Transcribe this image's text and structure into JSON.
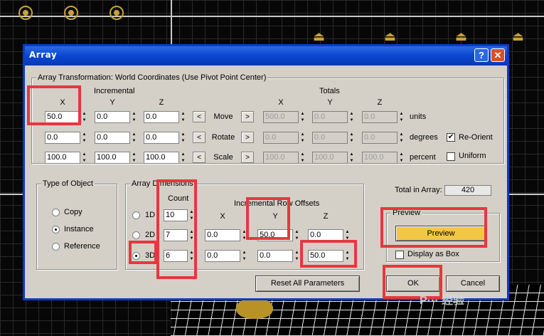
{
  "dialog": {
    "title": "Array",
    "help_label": "?",
    "close_label": "✕"
  },
  "transform": {
    "legend": "Array Transformation: World Coordinates (Use Pivot Point Center)",
    "incremental_label": "Incremental",
    "totals_label": "Totals",
    "axes": [
      "X",
      "Y",
      "Z"
    ],
    "rows": [
      {
        "label": "Move",
        "inc": [
          "50.0",
          "0.0",
          "0.0"
        ],
        "tot": [
          "500.0",
          "0.0",
          "0.0"
        ],
        "unit": "units"
      },
      {
        "label": "Rotate",
        "inc": [
          "0.0",
          "0.0",
          "0.0"
        ],
        "tot": [
          "0.0",
          "0.0",
          "0.0"
        ],
        "unit": "degrees"
      },
      {
        "label": "Scale",
        "inc": [
          "100.0",
          "100.0",
          "100.0"
        ],
        "tot": [
          "100.0",
          "100.0",
          "100.0"
        ],
        "unit": "percent"
      }
    ],
    "left_arrow": "<",
    "right_arrow": ">",
    "reorient_label": "Re-Orient",
    "reorient_checked": true,
    "uniform_label": "Uniform",
    "uniform_checked": false
  },
  "type_of_object": {
    "legend": "Type of Object",
    "options": [
      "Copy",
      "Instance",
      "Reference"
    ],
    "selected": "Instance"
  },
  "array_dimensions": {
    "legend": "Array Dimensions",
    "count_label": "Count",
    "offsets_label": "Incremental Row Offsets",
    "axes": [
      "X",
      "Y",
      "Z"
    ],
    "rows": [
      {
        "label": "1D",
        "count": "10",
        "offsets": null
      },
      {
        "label": "2D",
        "count": "7",
        "offsets": [
          "0.0",
          "50.0",
          "0.0"
        ]
      },
      {
        "label": "3D",
        "count": "6",
        "offsets": [
          "0.0",
          "0.0",
          "50.0"
        ]
      }
    ],
    "selected": "3D"
  },
  "total": {
    "label": "Total in Array:",
    "value": "420"
  },
  "preview": {
    "legend": "Preview",
    "button_label": "Preview",
    "display_as_box_label": "Display as Box",
    "display_as_box_checked": false
  },
  "buttons": {
    "reset_label": "Reset All Parameters",
    "ok_label": "OK",
    "cancel_label": "Cancel"
  },
  "watermark": "P··· 经验",
  "colors": {
    "title_bar": "#0a46d0",
    "dialog_bg": "#d4d0c8",
    "preview_button": "#f2c843",
    "highlight_box": "#e5383f",
    "teapot": "#c8a23a"
  }
}
